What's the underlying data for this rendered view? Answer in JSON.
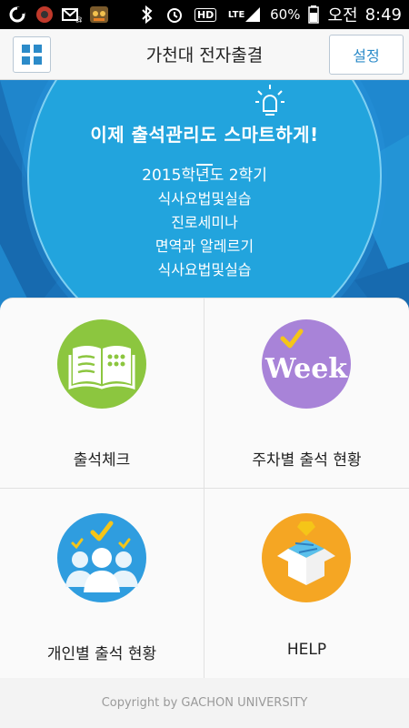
{
  "status_bar": {
    "battery": "60%",
    "time_prefix": "오전",
    "time": "8:49",
    "network": "LTE",
    "hd": "HD"
  },
  "header": {
    "title": "가천대 전자출결",
    "settings_label": "설정"
  },
  "hero": {
    "headline": "이제 출석관리도 스마트하게!",
    "term": "2015학년도 2학기",
    "courses": [
      "식사요법및실습",
      "진로세미나",
      "면역과 알레르기",
      "식사요법및실습"
    ]
  },
  "menu": {
    "attendance_check": "출석체크",
    "weekly_status": "주차별 출석 현황",
    "individual_status": "개인별 출석 현황",
    "help": "HELP",
    "weekly_icon_text": "Week"
  },
  "footer": {
    "copyright": "Copyright by GACHON UNIVERSITY"
  },
  "colors": {
    "accent": "#2c8bc9",
    "hero_circle": "#22a4dd",
    "green": "#8cc63f",
    "purple": "#a883d8",
    "blue": "#2f9ddf",
    "orange": "#f5a623"
  }
}
